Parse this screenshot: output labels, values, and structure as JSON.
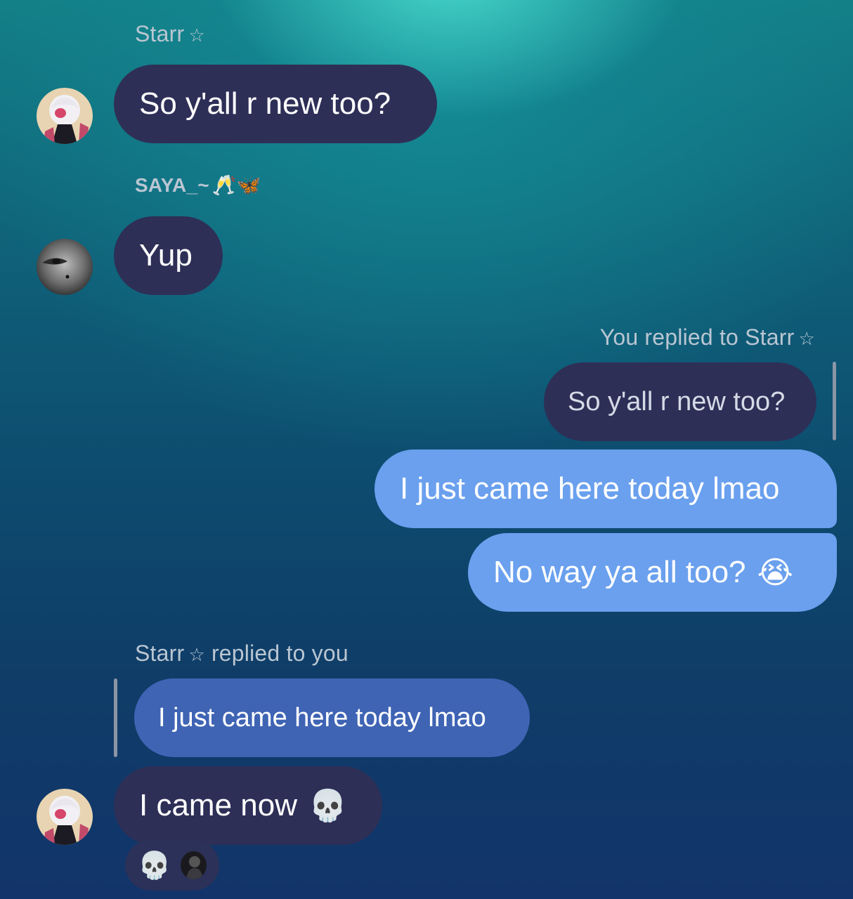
{
  "messages": {
    "m1": {
      "sender": "Starr",
      "sender_star": "☆",
      "text": "So y'all r new too?"
    },
    "m2": {
      "sender": "SAYA_~",
      "sender_emoji": "🥂🦋",
      "text": "Yup"
    },
    "m3": {
      "reply_label": "You replied to Starr",
      "reply_star": "☆",
      "quoted_text": "So y'all r new too?",
      "text": "I just came here today lmao"
    },
    "m4": {
      "text": "No way ya all too?",
      "emoji": "😭"
    },
    "m5": {
      "reply_label_sender": "Starr",
      "reply_label_star": "☆",
      "reply_label_rest": "replied to you",
      "quoted_text": "I just came here today lmao",
      "text": "I came now",
      "emoji": "💀"
    },
    "reaction": {
      "emoji": "💀"
    }
  },
  "colors": {
    "incoming_bubble": "#2e2f57",
    "outgoing_bubble": "#6aa0ee",
    "quoted_outgoing_bubble": "#3f64b4",
    "label_text": "#b9c6d2"
  },
  "icons": {
    "avatar_starr": "avatar-starr-icon",
    "avatar_saya": "avatar-saya-icon",
    "reaction_avatar": "reaction-avatar-icon"
  }
}
